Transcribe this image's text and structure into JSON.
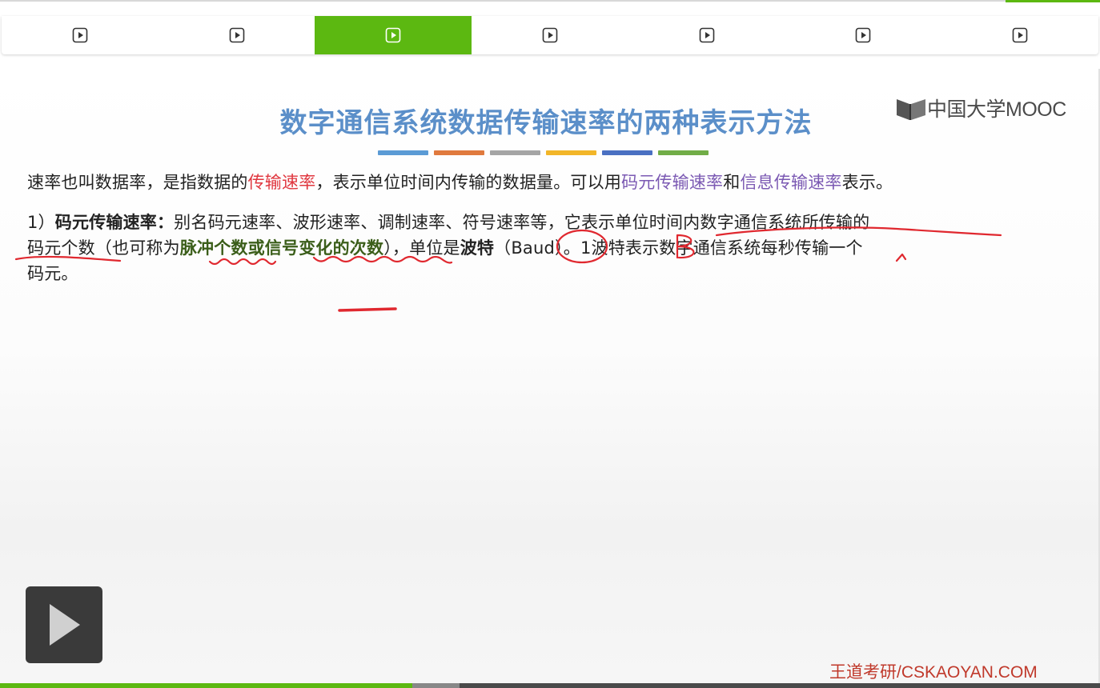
{
  "tabs": [
    {
      "icon": "play-icon",
      "active": false
    },
    {
      "icon": "play-icon",
      "active": false
    },
    {
      "icon": "play-icon",
      "active": true
    },
    {
      "icon": "play-icon",
      "active": false
    },
    {
      "icon": "play-icon",
      "active": false
    },
    {
      "icon": "play-icon",
      "active": false
    },
    {
      "icon": "play-icon",
      "active": false
    }
  ],
  "slide": {
    "title": "数字通信系统数据传输速率的两种表示方法",
    "logo_text": "中国大学MOOC",
    "accent_bars": [
      "#5b9bd5",
      "#e07a3e",
      "#a5a5a5",
      "#f2b629",
      "#4a70c2",
      "#71ad47"
    ],
    "para1": {
      "a": "速率也叫数据率，是指数据的",
      "b": "传输速率",
      "c": "，表示单位时间内传输的数据量。可以用",
      "d": "码元传输速率",
      "e": "和",
      "f": "信息传输速率",
      "g": "表示。"
    },
    "para2": {
      "prefix": "1）",
      "term": "码元传输速率",
      "colon": "：",
      "line1_rest": "别名码元速率、波形速率、调制速率、符号速率等，它表示单位时间内数字通信系统所传输的",
      "line2_a": "码元个数（也可称为",
      "line2_b": "脉冲个数或信号变化的次数",
      "line2_c": "），单位是",
      "line2_d": "波特",
      "line2_e": "（Baud）",
      "line2_f": "。1波特表示数字通信系统每秒传输一个",
      "line3": "码元。"
    },
    "watermark": "王道考研/CSKAOYAN.COM"
  },
  "player": {
    "big_play_icon": "play-icon",
    "progress_played": 0.375,
    "progress_buffered_end": 0.418
  },
  "colors": {
    "accent_green": "#5cb811",
    "title_blue": "#5b8fc9",
    "highlight_red": "#e0373f",
    "highlight_purple": "#7b59b3",
    "highlight_green": "#3b5e1a"
  }
}
